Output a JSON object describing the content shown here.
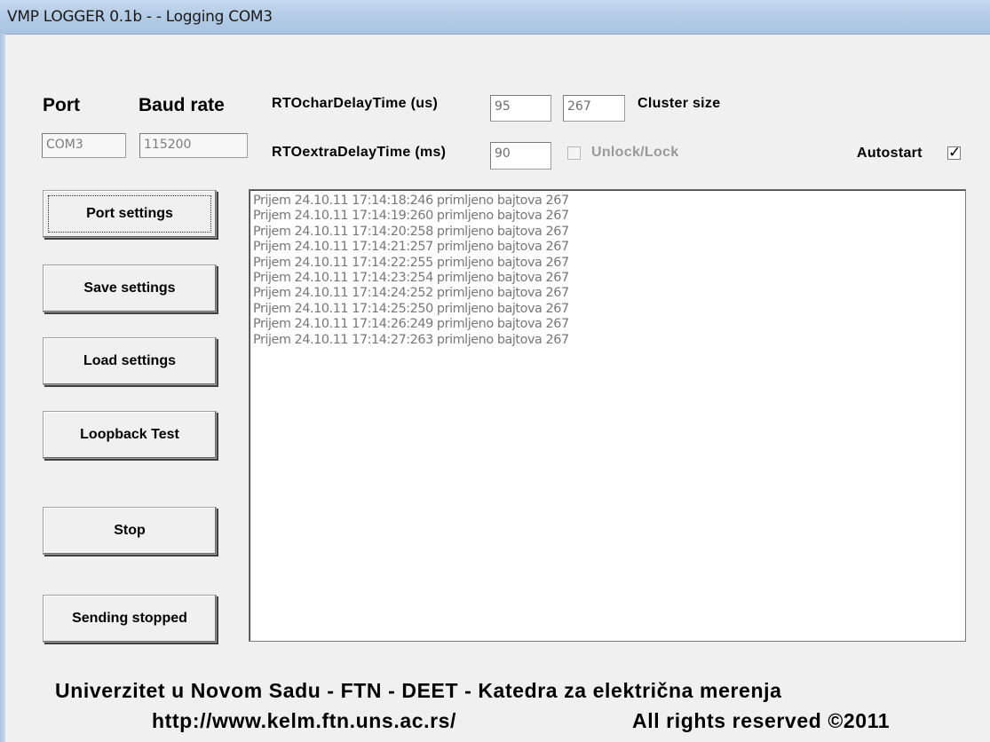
{
  "window": {
    "title": "VMP LOGGER 0.1b - - Logging COM3"
  },
  "settings": {
    "port_label": "Port",
    "baud_label": "Baud rate",
    "port_value": "COM3",
    "baud_value": "115200",
    "rto_char_label": "RTOcharDelayTime (us)",
    "rto_char_value": "95",
    "cluster_value": "267",
    "cluster_label": "Cluster size",
    "rto_extra_label": "RTOextraDelayTime (ms)",
    "rto_extra_value": "90",
    "unlock_label": "Unlock/Lock",
    "unlock_checked": false,
    "autostart_label": "Autostart",
    "autostart_checked": true
  },
  "buttons": {
    "port_settings": "Port settings",
    "save_settings": "Save settings",
    "load_settings": "Load settings",
    "loopback_test": "Loopback Test",
    "stop": "Stop",
    "sending_status": "Sending stopped"
  },
  "log": {
    "lines": [
      "Prijem  24.10.11 17:14:18:246 primljeno bajtova 267",
      "Prijem  24.10.11 17:14:19:260 primljeno bajtova 267",
      "Prijem  24.10.11 17:14:20:258 primljeno bajtova 267",
      "Prijem  24.10.11 17:14:21:257 primljeno bajtova 267",
      "Prijem  24.10.11 17:14:22:255 primljeno bajtova 267",
      "Prijem  24.10.11 17:14:23:254 primljeno bajtova 267",
      "Prijem  24.10.11 17:14:24:252 primljeno bajtova 267",
      "Prijem  24.10.11 17:14:25:250 primljeno bajtova 267",
      "Prijem  24.10.11 17:14:26:249 primljeno bajtova 267",
      "Prijem  24.10.11 17:14:27:263 primljeno bajtova 267"
    ]
  },
  "footer": {
    "line1": "Univerzitet u Novom Sadu - FTN - DEET - Katedra za električna merenja",
    "url": "http://www.kelm.ftn.uns.ac.rs/",
    "rights": "All rights reserved ©2011"
  }
}
